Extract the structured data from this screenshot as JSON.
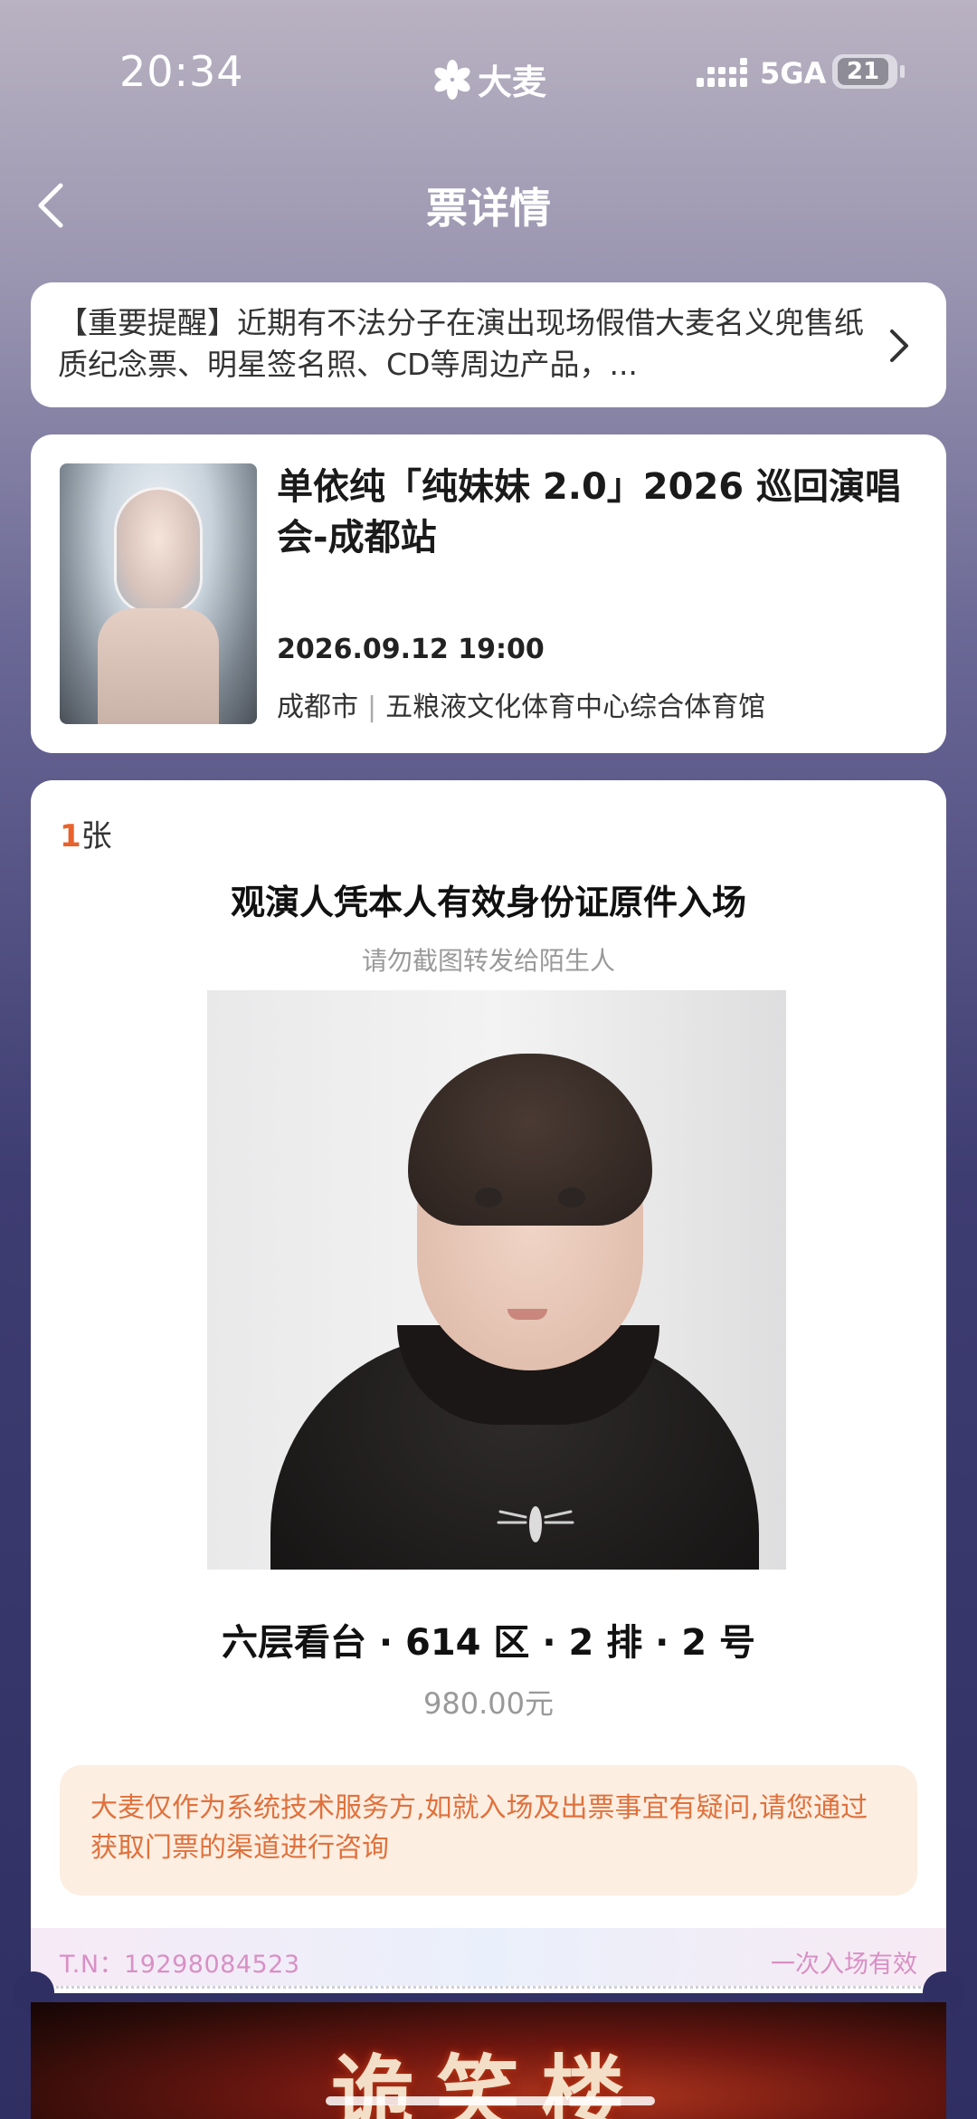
{
  "status_bar": {
    "time": "20:34",
    "brand": "大麦",
    "network": "5GA",
    "battery": "21"
  },
  "nav": {
    "title": "票详情",
    "back_icon": "chevron-left-icon"
  },
  "notice": {
    "text": "【重要提醒】近期有不法分子在演出现场假借大麦名义兜售纸质纪念票、明星签名照、CD等周边产品，...",
    "chevron_icon": "chevron-right-icon"
  },
  "event": {
    "title": "单依纯「纯妹妹 2.0」2026 巡回演唱会-成都站",
    "datetime": "2026.09.12 19:00",
    "city": "成都市",
    "venue": "五粮液文化体育中心综合体育馆"
  },
  "ticket": {
    "count": "1",
    "count_unit": "张",
    "heading": "观演人凭本人有效身份证原件入场",
    "subheading": "请勿截图转发给陌生人",
    "seat": "六层看台 · 614 区 · 2 排 · 2 号",
    "price": "980.00元",
    "disclaimer": "大麦仅作为系统技术服务方,如就入场及出票事宜有疑问,请您通过获取门票的渠道进行咨询",
    "tn": "T.N：19298084523",
    "entry_note": "一次入场有效"
  },
  "banner": {
    "title": "诡笑楼"
  },
  "colors": {
    "accent_orange": "#e9622b",
    "disclaimer_bg": "#fdeee2",
    "disclaimer_text": "#e0713c",
    "tn_text": "#d990c4"
  }
}
